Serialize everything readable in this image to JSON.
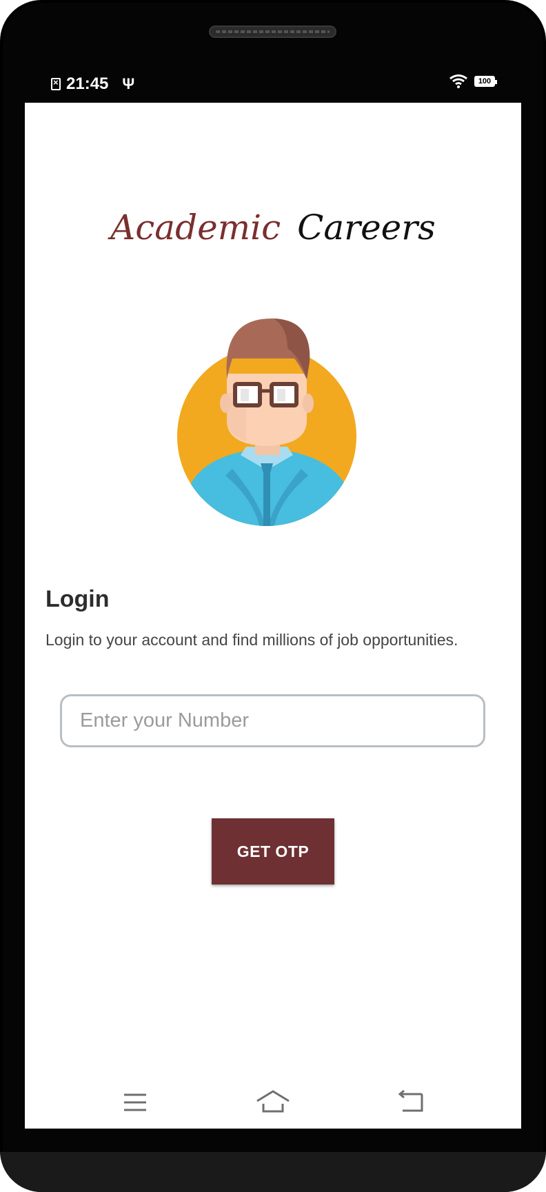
{
  "status_bar": {
    "time": "21:45",
    "battery_level": "100",
    "icons": [
      "sim-error-icon",
      "usb-icon",
      "wifi-icon",
      "battery-icon"
    ]
  },
  "app": {
    "brand_first": "Academic",
    "brand_second": "Careers",
    "brand_colors": {
      "first": "#7a2f2f",
      "second": "#111111"
    }
  },
  "login": {
    "title": "Login",
    "subtitle": "Login to your account and find millions of job opportunities.",
    "number_placeholder": "Enter your Number",
    "number_value": "",
    "otp_button_label": "GET OTP",
    "button_color": "#6e3033"
  },
  "nav": {
    "items": [
      "menu-icon",
      "home-icon",
      "back-icon"
    ]
  }
}
